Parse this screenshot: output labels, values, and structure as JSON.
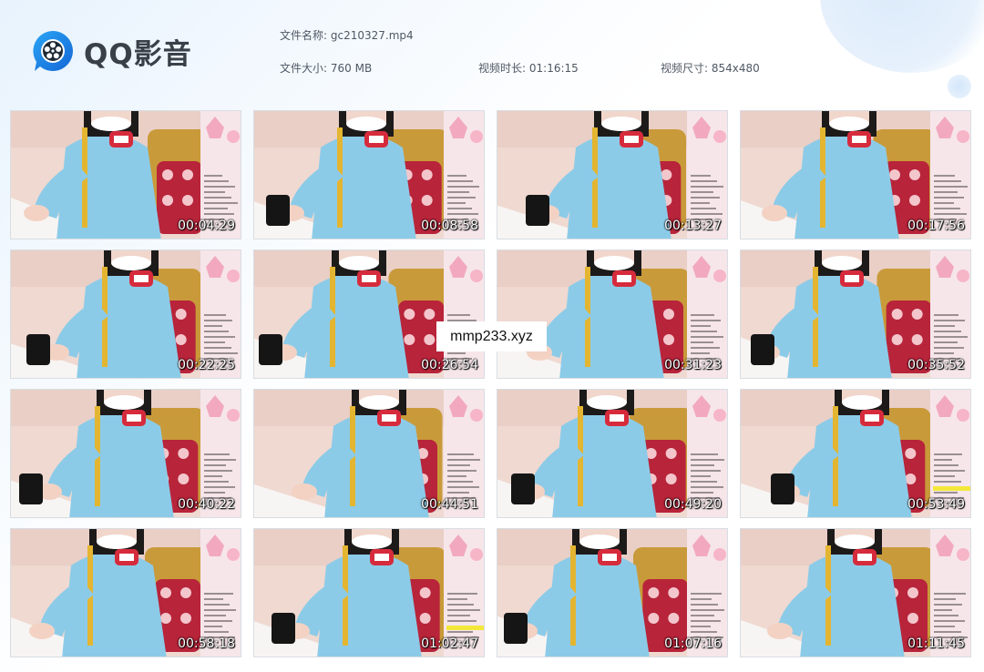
{
  "app": {
    "name": "QQ影音"
  },
  "file_info": {
    "name_label": "文件名称:",
    "name_value": "gc210327.mp4",
    "size_label": "文件大小:",
    "size_value": "760 MB",
    "duration_label": "视频时长:",
    "duration_value": "01:16:15",
    "dimensions_label": "视频尺寸:",
    "dimensions_value": "854x480"
  },
  "thumbnails": [
    "00:04:29",
    "00:08:58",
    "00:13:27",
    "00:17:56",
    "00:22:25",
    "00:26:54",
    "00:31:23",
    "00:35:52",
    "00:40:22",
    "00:44:51",
    "00:49:20",
    "00:53:49",
    "00:58:18",
    "01:02:47",
    "01:07:16",
    "01:11:45"
  ],
  "watermark": "mmp233.xyz",
  "colors": {
    "accent": "#1f7fe0",
    "jacket": "#8ccbe8",
    "badge": "#d62b3c",
    "chair": "#b8243a"
  }
}
